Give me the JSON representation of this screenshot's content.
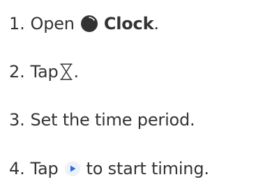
{
  "steps": [
    {
      "number": "1.",
      "before": "Open",
      "icon": "clock-app-icon",
      "app_name": "Clock",
      "after": "."
    },
    {
      "number": "2.",
      "before": "Tap",
      "icon": "hourglass-timer-icon",
      "after": "."
    },
    {
      "number": "3.",
      "text": "Set the time period."
    },
    {
      "number": "4.",
      "before": "Tap",
      "icon": "start-play-icon",
      "after": "to start timing."
    }
  ],
  "colors": {
    "text": "#333333",
    "clock_icon": "#333333",
    "play_icon_blue": "#1f6fe0",
    "play_icon_bg": "#eef2f8"
  }
}
